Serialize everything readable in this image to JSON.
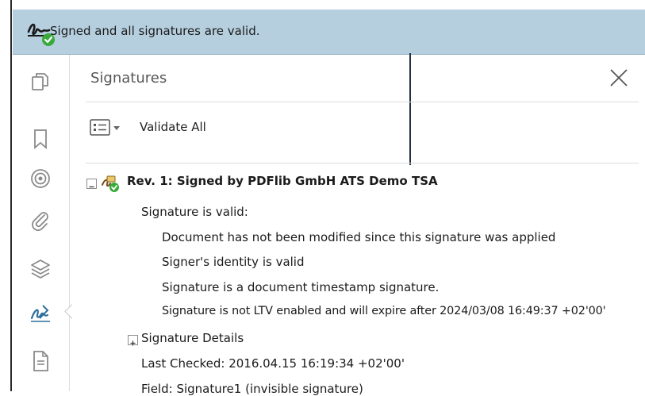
{
  "banner": {
    "status_text": "Signed and all signatures are valid.",
    "icon": "signature-valid-icon"
  },
  "rail": {
    "items": [
      {
        "icon": "page-thumbnails-icon"
      },
      {
        "icon": "bookmark-icon"
      },
      {
        "icon": "destinations-icon"
      },
      {
        "icon": "attachment-icon"
      },
      {
        "icon": "layers-icon"
      },
      {
        "icon": "signature-panel-icon"
      },
      {
        "icon": "document-icon"
      }
    ]
  },
  "panel": {
    "title": "Signatures",
    "close_icon": "close-icon",
    "toolbar": {
      "options_icon": "options-menu-icon",
      "validate_all_label": "Validate All"
    },
    "revision": {
      "title": "Rev. 1: Signed by PDFlib GmbH ATS Demo TSA",
      "status": "Signature is valid:",
      "details": [
        "Document has not been modified since this signature was applied",
        "Signer's identity is valid",
        "Signature is a document timestamp signature.",
        "Signature is not LTV enabled and will expire after 2024/03/08 16:49:37 +02'00'"
      ],
      "details_label": "Signature Details",
      "last_checked": "Last Checked: 2016.04.15 16:19:34 +02'00'",
      "field": "Field: Signature1 (invisible signature)"
    }
  },
  "colors": {
    "banner_bg": "#b6cfdf",
    "valid_green": "#3aaa3a"
  }
}
